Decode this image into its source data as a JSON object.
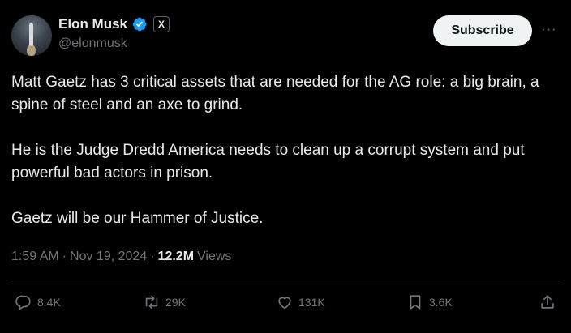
{
  "author": {
    "display_name": "Elon Musk",
    "handle": "@elonmusk",
    "verified_icon": "verified-badge-icon",
    "affiliate_badge": "X"
  },
  "header": {
    "subscribe_label": "Subscribe",
    "more_label": "···"
  },
  "tweet": {
    "paragraphs": [
      "Matt Gaetz has 3 critical assets that are needed for the AG role: a big brain, a spine of steel and an axe to grind.",
      "He is the Judge Dredd America needs to clean up a corrupt system and put powerful bad actors in prison.",
      "Gaetz will be our Hammer of Justice."
    ]
  },
  "meta": {
    "time": "1:59 AM",
    "separator": "·",
    "date": "Nov 19, 2024",
    "views_count": "12.2M",
    "views_label": "Views"
  },
  "actions": {
    "replies": "8.4K",
    "reposts": "29K",
    "likes": "131K",
    "bookmarks": "3.6K"
  },
  "colors": {
    "background": "#000000",
    "text": "#e7e9ea",
    "muted": "#71767b",
    "verified": "#1d9bf0",
    "button_bg": "#eff3f4"
  }
}
